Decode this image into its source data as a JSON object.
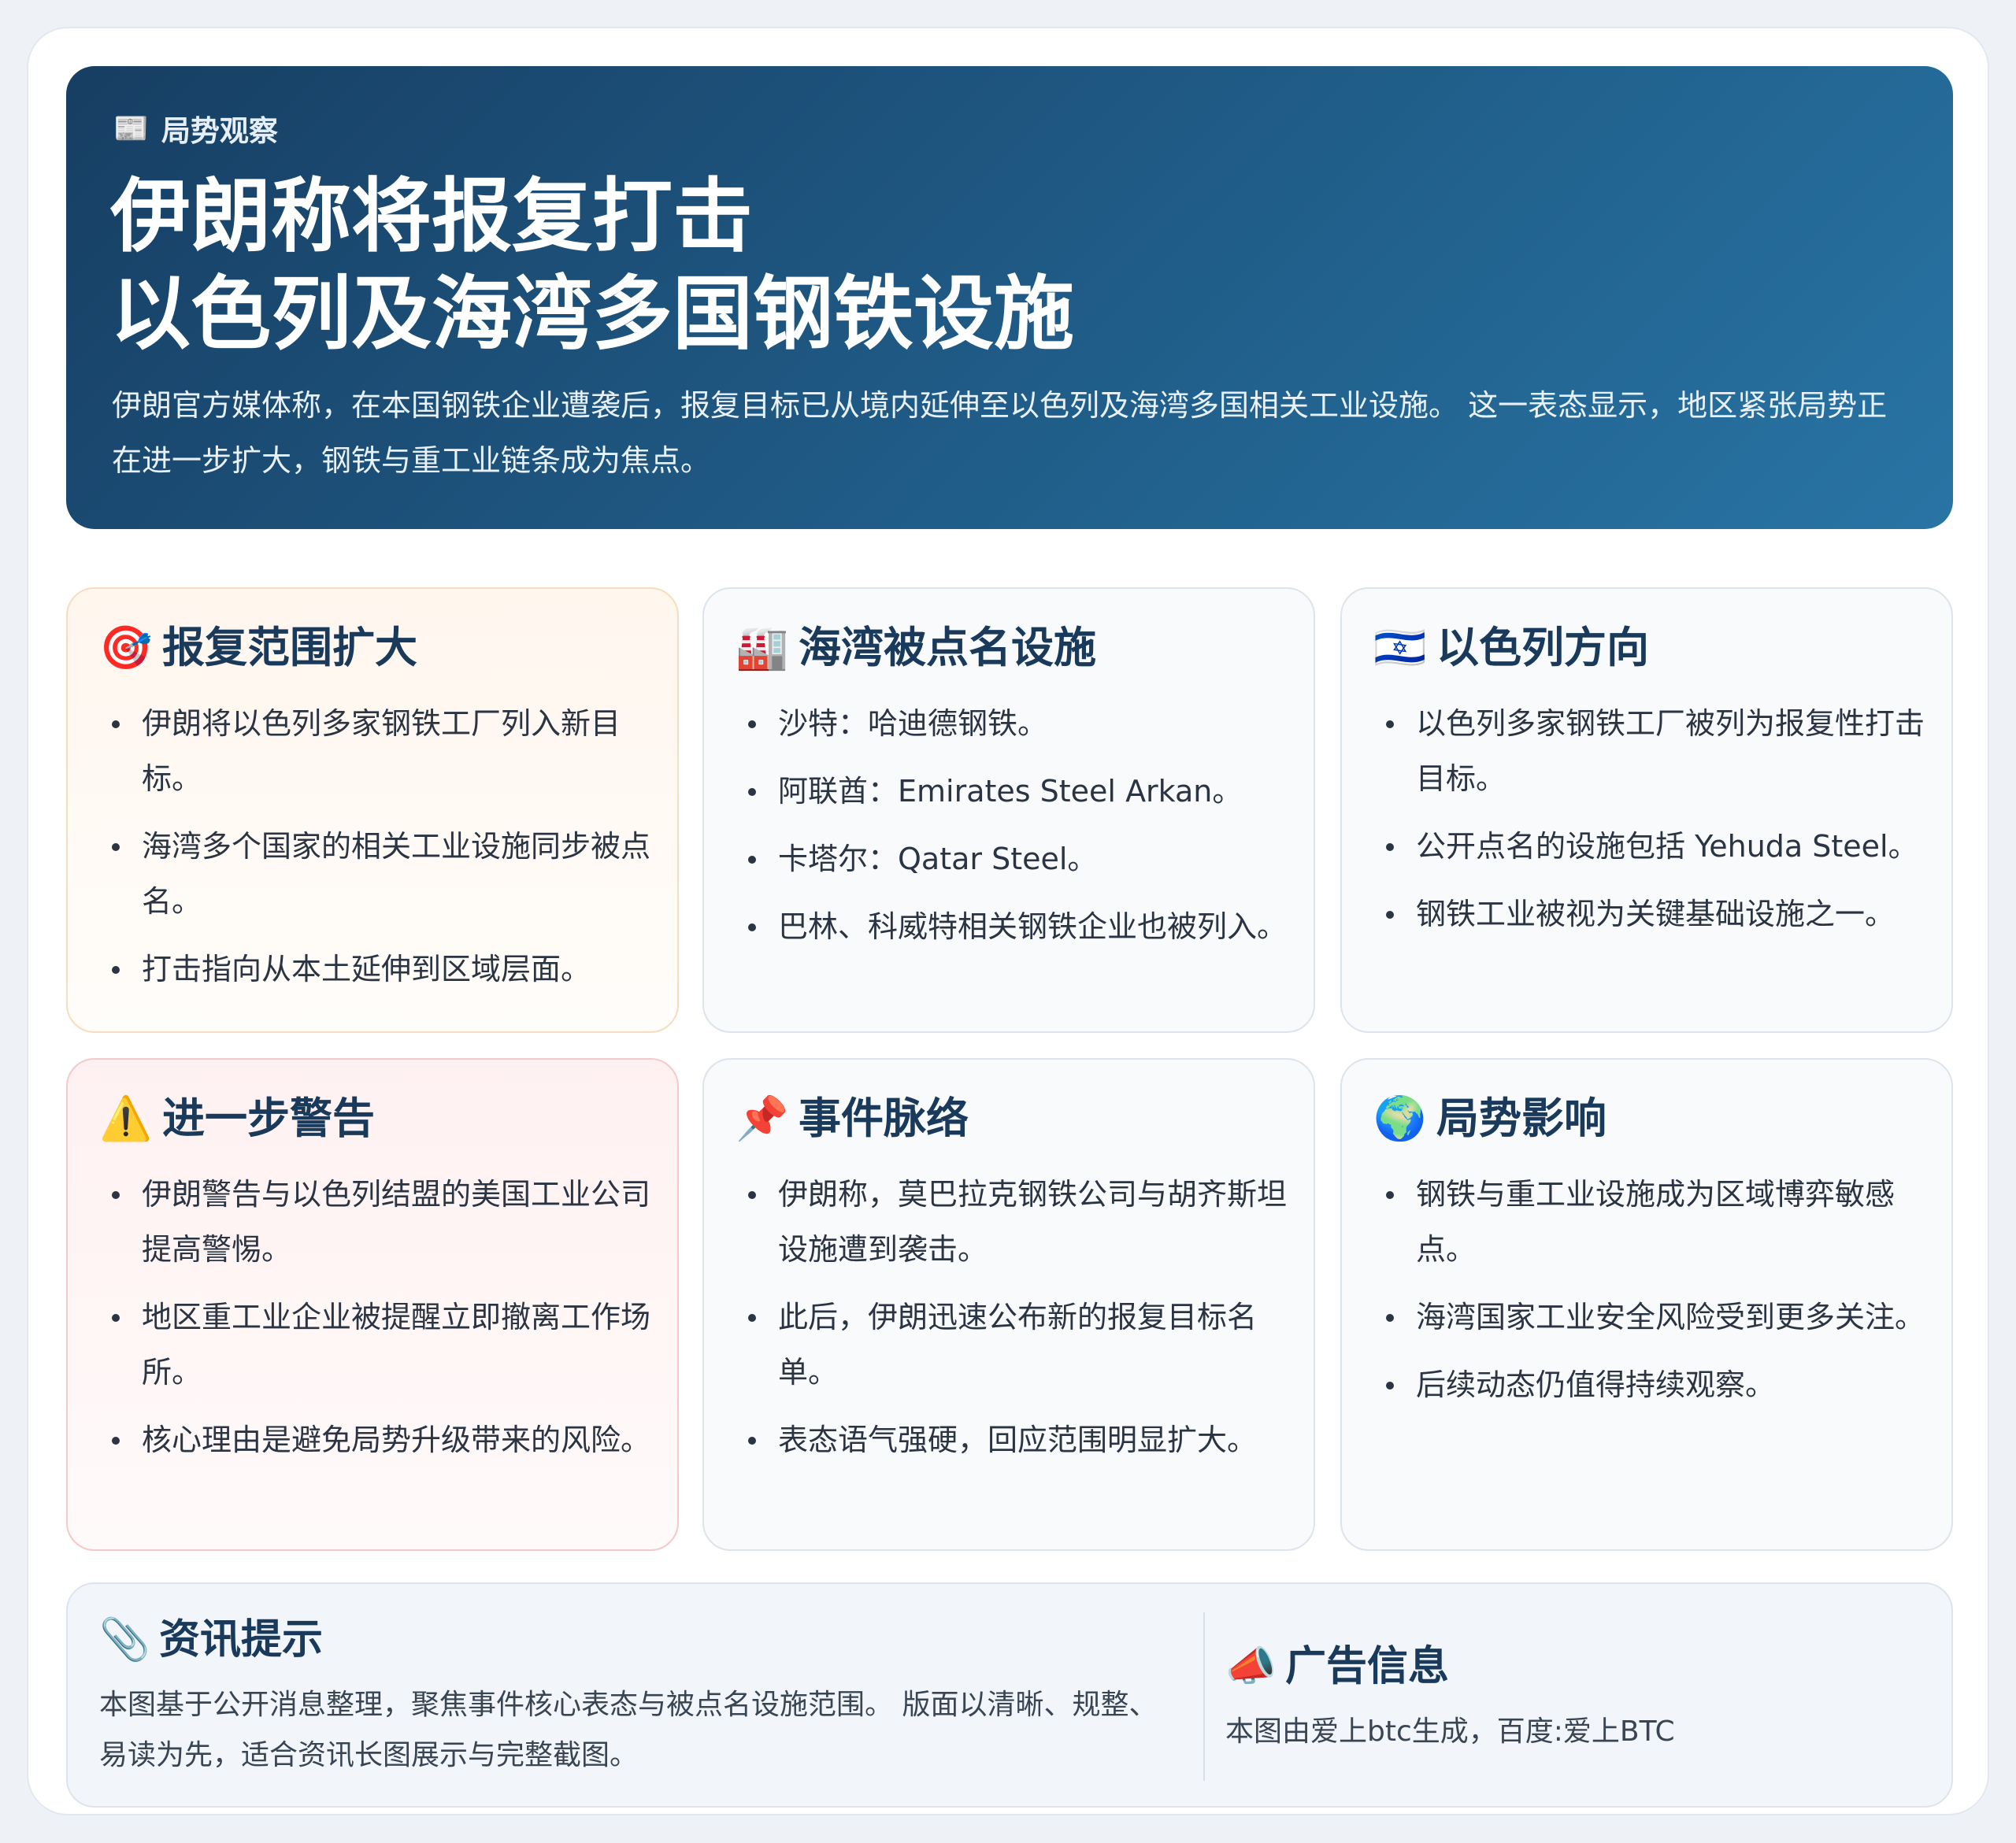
{
  "hero": {
    "kicker_icon": "📰",
    "kicker": "局势观察",
    "title_line1": "伊朗称将报复打击",
    "title_line2": "以色列及海湾多国钢铁设施",
    "summary": "伊朗官方媒体称，在本国钢铁企业遭袭后，报复目标已从境内延伸至以色列及海湾多国相关工业设施。 这一表态显示，地区紧张局势正在进一步扩大，钢铁与重工业链条成为焦点。"
  },
  "cards": [
    {
      "icon": "🎯",
      "title": "报复范围扩大",
      "items": [
        "伊朗将以色列多家钢铁工厂列入新目标。",
        "海湾多个国家的相关工业设施同步被点名。",
        "打击指向从本土延伸到区域层面。"
      ]
    },
    {
      "icon": "🏭",
      "title": "海湾被点名设施",
      "items": [
        "沙特：哈迪德钢铁。",
        "阿联酋：Emirates Steel Arkan。",
        "卡塔尔：Qatar Steel。",
        "巴林、科威特相关钢铁企业也被列入。"
      ]
    },
    {
      "icon": "🇮🇱",
      "title": "以色列方向",
      "items": [
        "以色列多家钢铁工厂被列为报复性打击目标。",
        "公开点名的设施包括 Yehuda Steel。",
        "钢铁工业被视为关键基础设施之一。"
      ]
    },
    {
      "icon": "⚠️",
      "title": "进一步警告",
      "items": [
        "伊朗警告与以色列结盟的美国工业公司提高警惕。",
        "地区重工业企业被提醒立即撤离工作场所。",
        "核心理由是避免局势升级带来的风险。"
      ]
    },
    {
      "icon": "📌",
      "title": "事件脉络",
      "items": [
        "伊朗称，莫巴拉克钢铁公司与胡齐斯坦设施遭到袭击。",
        "此后，伊朗迅速公布新的报复目标名单。",
        "表态语气强硬，回应范围明显扩大。"
      ]
    },
    {
      "icon": "🌍",
      "title": "局势影响",
      "items": [
        "钢铁与重工业设施成为区域博弈敏感点。",
        "海湾国家工业安全风险受到更多关注。",
        "后续动态仍值得持续观察。"
      ]
    }
  ],
  "footer": {
    "info_icon": "📎",
    "info_title": "资讯提示",
    "info_text": "本图基于公开消息整理，聚焦事件核心表态与被点名设施范围。 版面以清晰、规整、易读为先，适合资讯长图展示与完整截图。",
    "ad_icon": "📣",
    "ad_title": "广告信息",
    "ad_text": "本图由爱上btc生成，百度:爱上BTC"
  }
}
